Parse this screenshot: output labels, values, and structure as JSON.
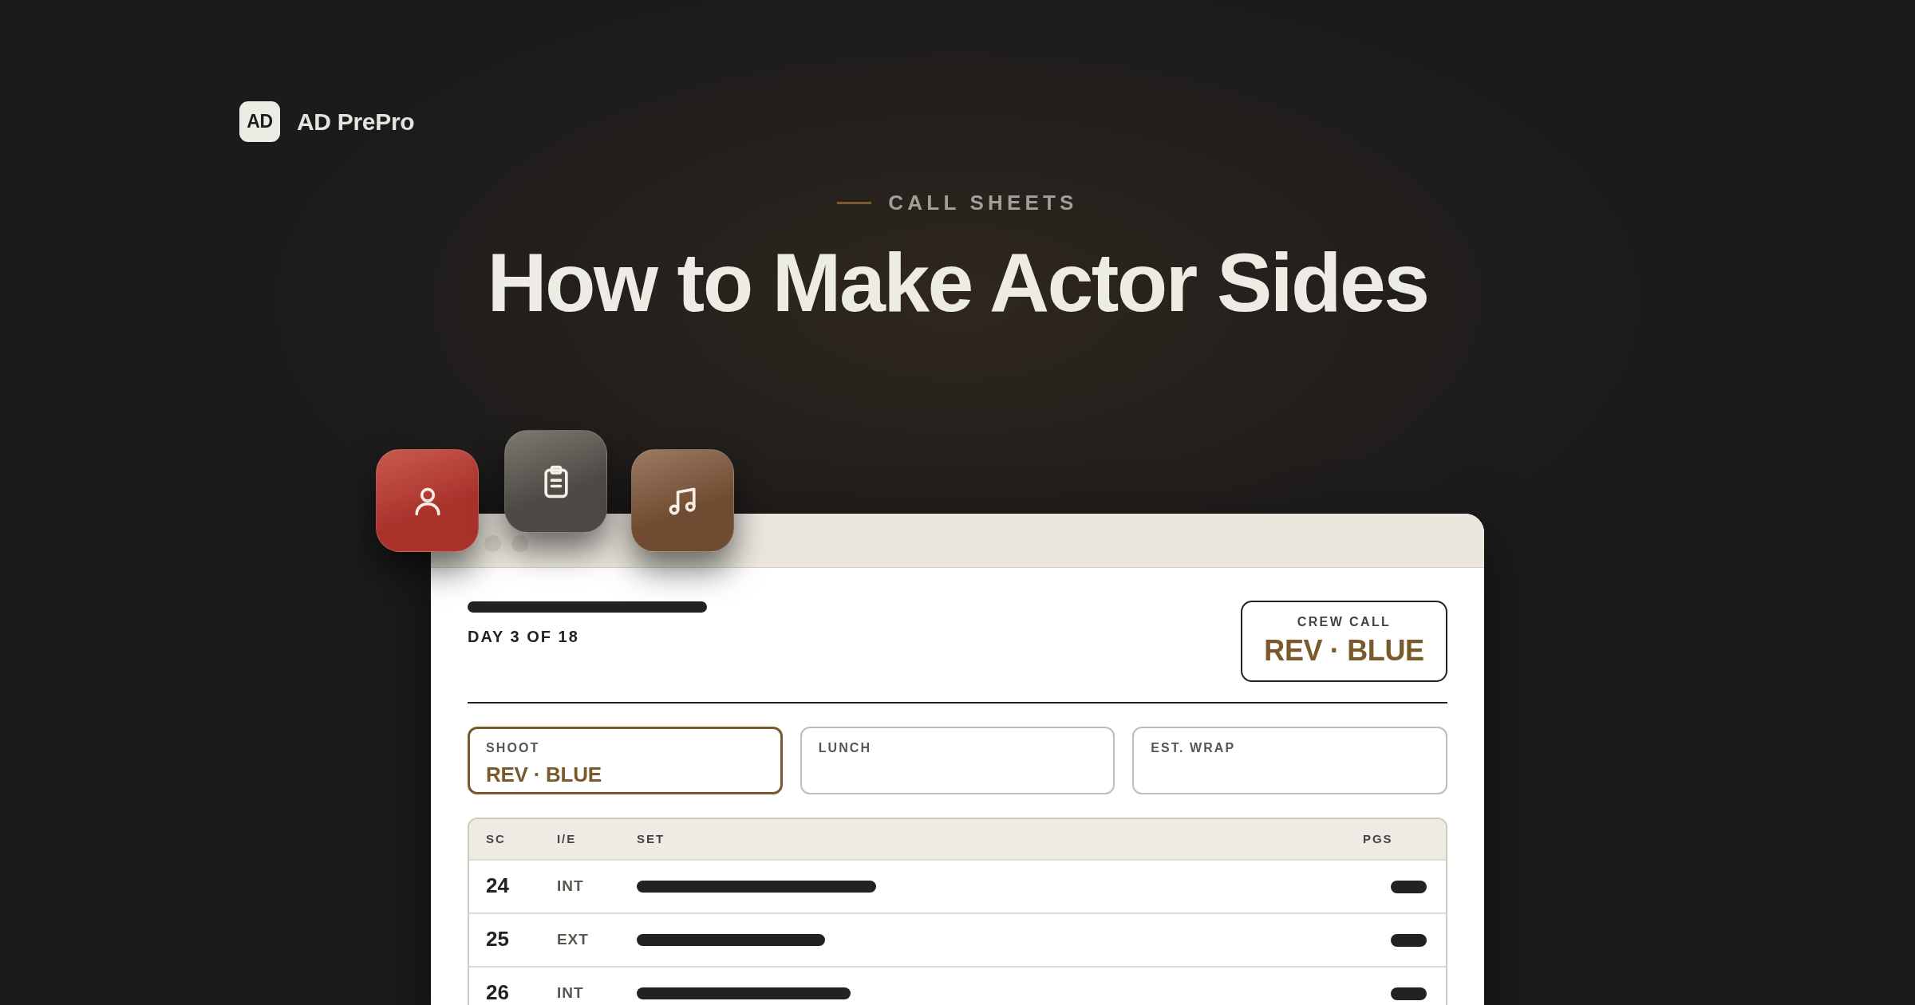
{
  "brand": {
    "logo": "AD",
    "name": "AD PrePro"
  },
  "eyebrow": "CALL SHEETS",
  "title": "How to Make Actor Sides",
  "call_sheet": {
    "day": "DAY 3 OF 18",
    "crew_call": {
      "label": "CREW CALL",
      "value": "REV · BLUE"
    },
    "times": [
      {
        "label": "SHOOT",
        "value": "REV · BLUE",
        "highlighted": true
      },
      {
        "label": "LUNCH",
        "highlighted": false
      },
      {
        "label": "EST. WRAP",
        "highlighted": false
      }
    ],
    "table": {
      "columns": [
        "SC",
        "I/E",
        "SET",
        "PGS"
      ],
      "rows": [
        {
          "sc": "24",
          "ie": "INT"
        },
        {
          "sc": "25",
          "ie": "EXT"
        },
        {
          "sc": "26",
          "ie": "INT"
        }
      ]
    }
  }
}
